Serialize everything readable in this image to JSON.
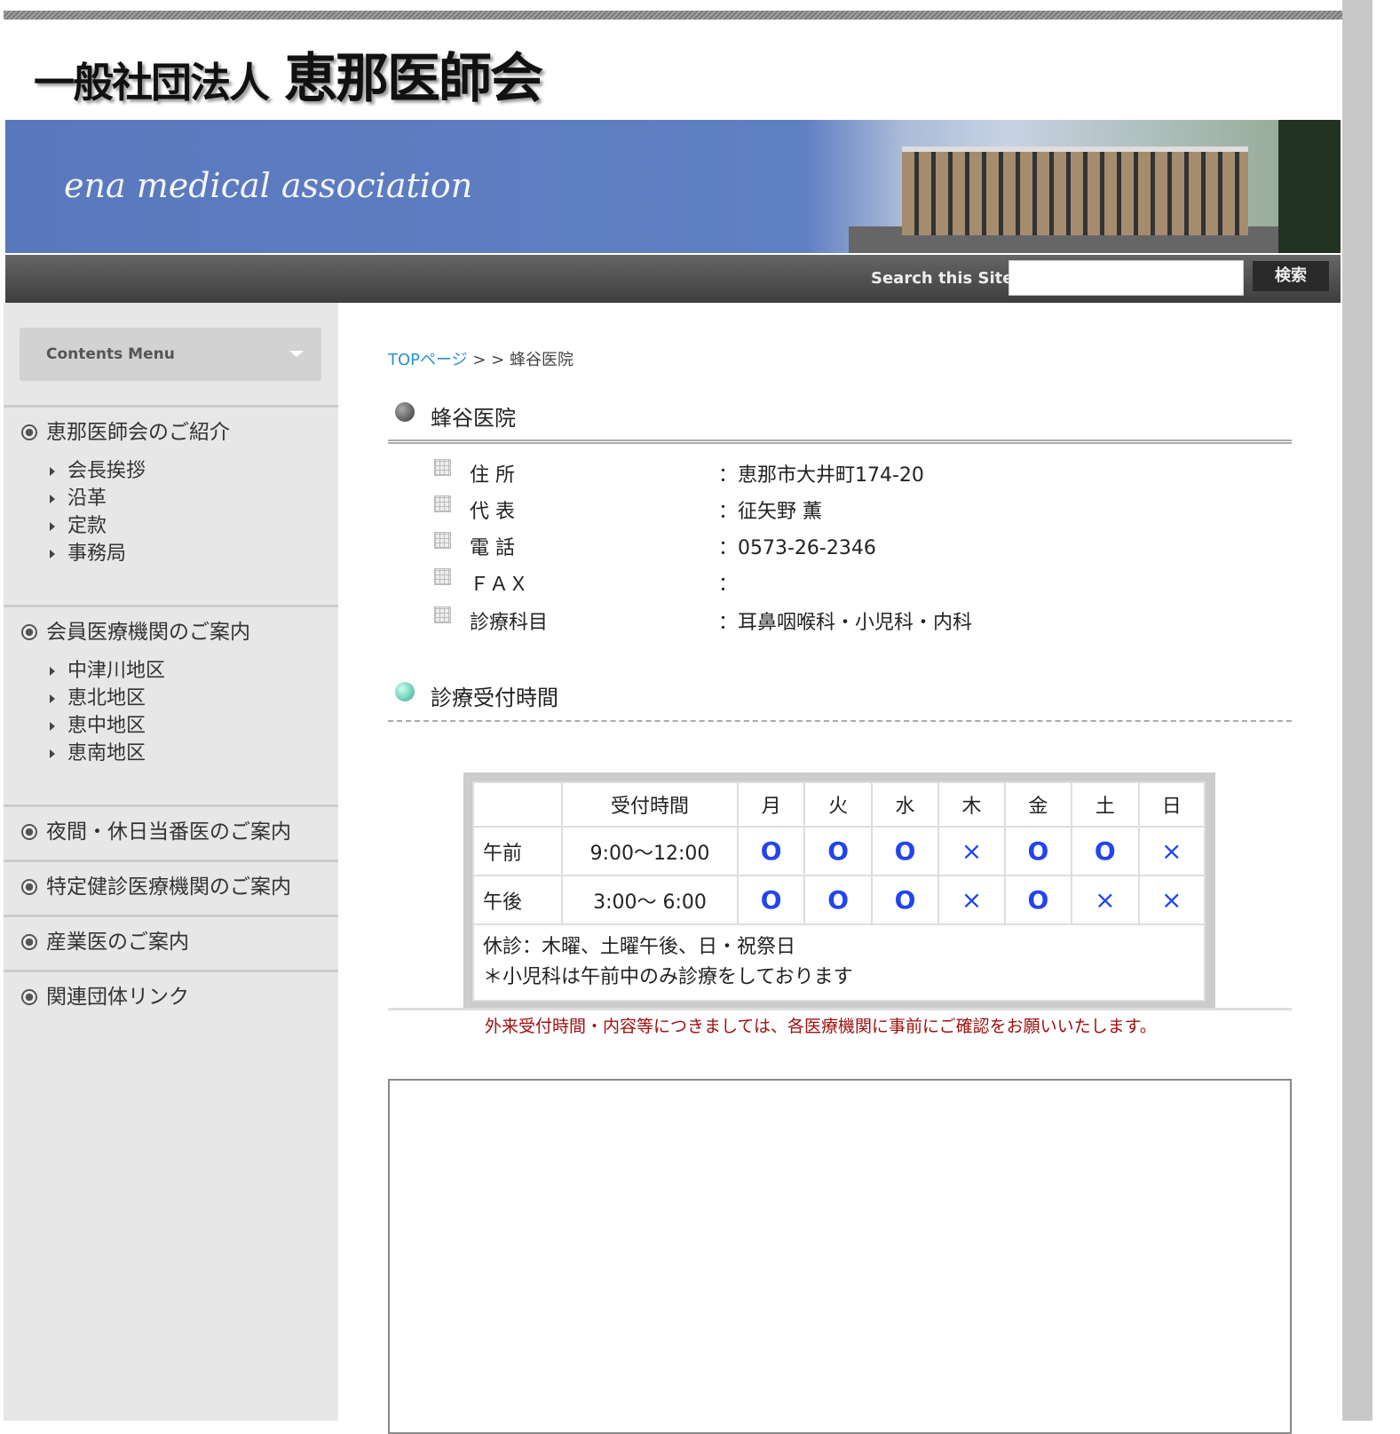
{
  "header": {
    "logo_small": "一般社団法人",
    "logo_large": "恵那医師会",
    "tagline": "ena medical association"
  },
  "search": {
    "label": "Search this Site",
    "placeholder": "",
    "button": "検索"
  },
  "sidebar": {
    "menu_title": "Contents Menu",
    "sections": [
      {
        "title": "恵那医師会のご紹介",
        "items": [
          "会長挨拶",
          "沿革",
          "定款",
          "事務局"
        ]
      },
      {
        "title": "会員医療機関のご案内",
        "items": [
          "中津川地区",
          "恵北地区",
          "恵中地区",
          "恵南地区"
        ]
      },
      {
        "title": "夜間・休日当番医のご案内",
        "items": []
      },
      {
        "title": "特定健診医療機関のご案内",
        "items": []
      },
      {
        "title": "産業医のご案内",
        "items": []
      },
      {
        "title": "関連団体リンク",
        "items": []
      }
    ]
  },
  "breadcrumb": {
    "top": "TOPページ",
    "sep": "> >",
    "current": "蜂谷医院"
  },
  "clinic": {
    "name": "蜂谷医院",
    "info": [
      {
        "key": "住 所",
        "value": "：恵那市大井町174-20"
      },
      {
        "key": "代 表",
        "value": "：征矢野 薫"
      },
      {
        "key": "電 話",
        "value": "：0573-26-2346"
      },
      {
        "key": "ＦＡＸ",
        "value": "："
      },
      {
        "key": "診療科目",
        "value": "：耳鼻咽喉科・小児科・内科"
      }
    ]
  },
  "hours": {
    "title": "診療受付時間",
    "headers": [
      "",
      "受付時間",
      "月",
      "火",
      "水",
      "木",
      "金",
      "土",
      "日"
    ],
    "rows": [
      {
        "label": "午前",
        "time": "9:00〜12:00",
        "marks": [
          "O",
          "O",
          "O",
          "×",
          "O",
          "O",
          "×"
        ]
      },
      {
        "label": "午後",
        "time": "3:00〜 6:00",
        "marks": [
          "O",
          "O",
          "O",
          "×",
          "O",
          "×",
          "×"
        ]
      }
    ],
    "note1": "休診：木曜、土曜午後、日・祝祭日",
    "note2": "＊小児科は午前中のみ診療をしております"
  },
  "notice": "外来受付時間・内容等につきましては、各医療機関に事前にご確認をお願いいたします。"
}
